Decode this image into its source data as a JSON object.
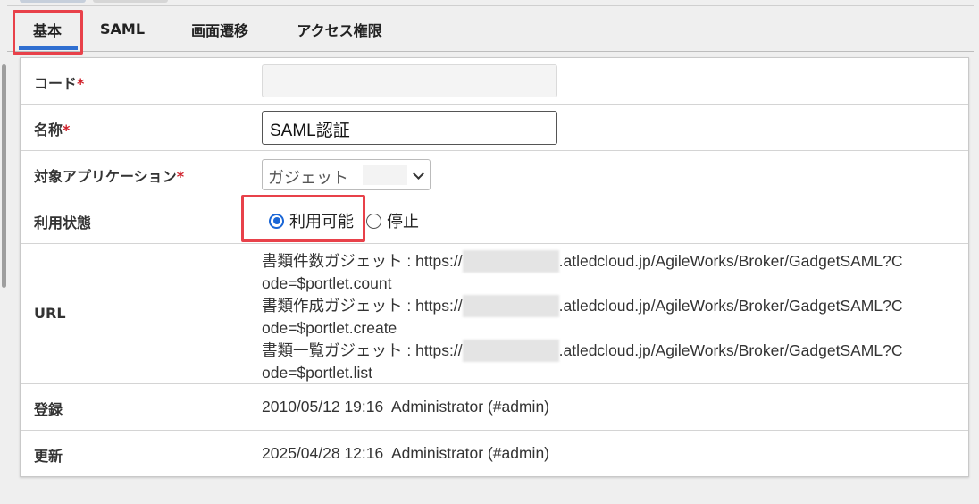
{
  "tabs": [
    {
      "label": "基本",
      "active": true
    },
    {
      "label": "SAML",
      "active": false
    },
    {
      "label": "画面遷移",
      "active": false
    },
    {
      "label": "アクセス権限",
      "active": false
    }
  ],
  "form": {
    "code": {
      "label": "コード",
      "required_mark": "*",
      "value": ""
    },
    "name": {
      "label": "名称",
      "required_mark": "*",
      "value": "SAML認証"
    },
    "app": {
      "label": "対象アプリケーション",
      "required_mark": "*",
      "selected": "ガジェット"
    },
    "status": {
      "label": "利用状態",
      "options": [
        "利用可能",
        "停止"
      ],
      "selected": "利用可能"
    },
    "url": {
      "label": "URL",
      "lines": [
        {
          "prefix": "書類件数ガジェット : https://",
          "suffix": ".atledcloud.jp/AgileWorks/Broker/GadgetSAML?C",
          "cont": "ode=$portlet.count"
        },
        {
          "prefix": "書類作成ガジェット : https://",
          "suffix": ".atledcloud.jp/AgileWorks/Broker/GadgetSAML?C",
          "cont": "ode=$portlet.create"
        },
        {
          "prefix": "書類一覧ガジェット : https://",
          "suffix": ".atledcloud.jp/AgileWorks/Broker/GadgetSAML?C",
          "cont": "ode=$portlet.list"
        }
      ]
    },
    "registered": {
      "label": "登録",
      "value": "2010/05/12 19:16  Administrator (#admin)"
    },
    "updated": {
      "label": "更新",
      "value": "2025/04/28 12:16  Administrator (#admin)"
    }
  },
  "colors": {
    "accent": "#2f6fd1",
    "highlight": "#e8414a",
    "required": "#d0202a"
  }
}
